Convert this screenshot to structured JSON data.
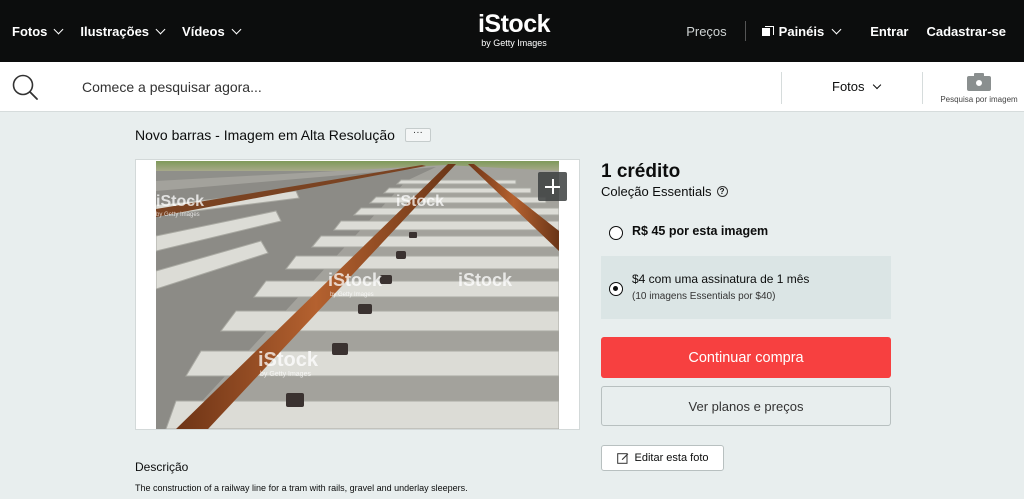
{
  "nav": {
    "items": [
      {
        "label": "Fotos"
      },
      {
        "label": "Ilustrações"
      },
      {
        "label": "Vídeos"
      }
    ],
    "logo_main": "iStock",
    "logo_sub": "by Getty Images",
    "precos": "Preços",
    "paineis": "Painéis",
    "entrar": "Entrar",
    "cadastrar": "Cadastrar-se"
  },
  "search": {
    "placeholder": "Comece a pesquisar agora...",
    "filter": "Fotos",
    "image_search_label": "Pesquisa por imagem"
  },
  "asset": {
    "title": "Novo barras - Imagem em Alta Resolução",
    "more_label": "···",
    "watermark": "iStock",
    "watermark_sub": "by Getty Images"
  },
  "purchase": {
    "price": "1 crédito",
    "collection": "Coleção Essentials",
    "help": "?",
    "option1": "R$ 45 por esta imagem",
    "option2_main": "$4 com uma assinatura de 1 mês",
    "option2_sub": "(10 imagens Essentials por $40)",
    "continue_label": "Continuar compra",
    "plans_label": "Ver planos e preços",
    "edit_label": "Editar esta foto"
  },
  "description": {
    "heading": "Descrição",
    "text": "The construction of a railway line for a tram with rails, gravel and underlay sleepers."
  },
  "colors": {
    "topbar": "#0c0d0d",
    "background": "#e8eeee",
    "primary": "#f74040",
    "selected_option": "#dbe5e5"
  },
  "icons": [
    "chevron-down-icon",
    "boards-icon",
    "search-icon",
    "camera-icon",
    "plus-icon",
    "help-icon",
    "edit-icon"
  ]
}
